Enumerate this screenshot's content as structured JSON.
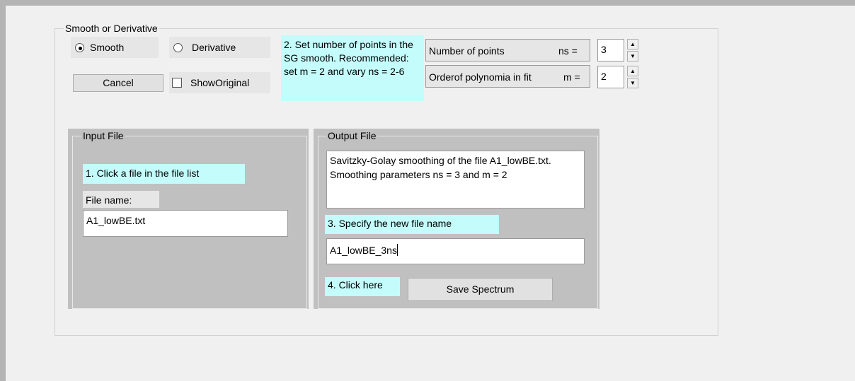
{
  "group": {
    "title": "Smooth or Derivative"
  },
  "mode": {
    "smooth_label": "Smooth",
    "derivative_label": "Derivative",
    "selected": "Smooth"
  },
  "cancel_label": "Cancel",
  "show_original_label": "ShowOriginal",
  "instructions": {
    "step2": "2. Set number of points in the SG smooth. Recommended: set m = 2 and vary ns = 2-6",
    "step1": "1. Click a file in the file list",
    "step3": "3. Specify the new file name",
    "step4": "4. Click here"
  },
  "params": {
    "ns_label": "Number of points",
    "ns_symbol": "ns =",
    "ns_value": "3",
    "m_label": "Orderof polynomia in fit",
    "m_symbol": "m =",
    "m_value": "2"
  },
  "input_file": {
    "title": "Input File",
    "file_name_label": "File name:",
    "file_name_value": "A1_lowBE.txt"
  },
  "output_file": {
    "title": "Output File",
    "description": "Savitzky-Golay smoothing of the file A1_lowBE.txt. Smoothing parameters ns = 3 and m = 2",
    "new_name_value": "A1_lowBE_3ns",
    "save_label": "Save Spectrum"
  },
  "icons": {
    "spin_up": "spin-up-icon",
    "spin_down": "spin-down-icon"
  },
  "colors": {
    "hint_bg": "#c4fcfc",
    "panel_gray": "#c0c0c0",
    "window_bg": "#f0f0f0"
  }
}
